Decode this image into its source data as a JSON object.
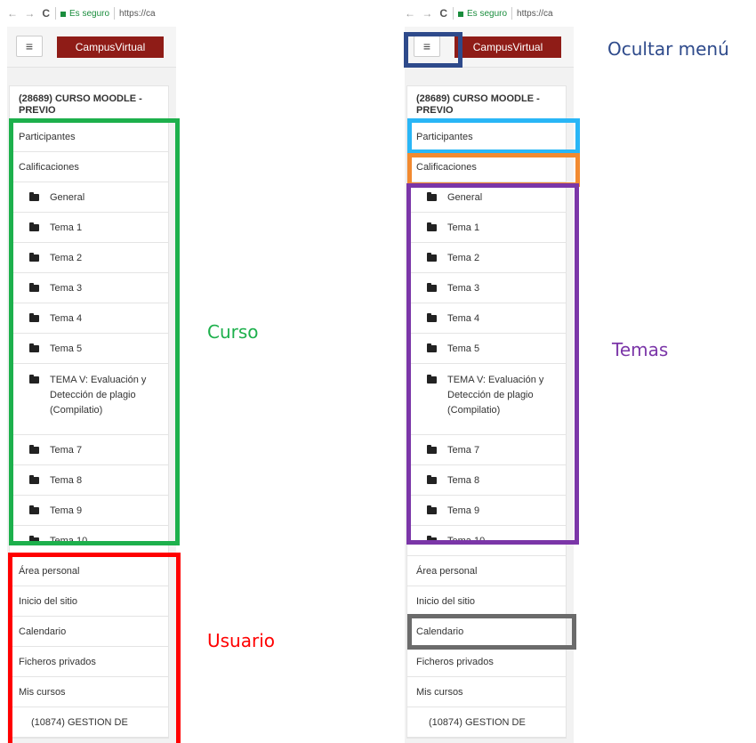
{
  "browser": {
    "nav_arrows": "← →",
    "reload_icon": "C",
    "secure_label": "Es seguro",
    "url": "https://ca"
  },
  "navbar": {
    "menu_icon": "≡",
    "brand": "CampusVirtual"
  },
  "course": {
    "title": "(28689) CURSO MOODLE - PREVIO",
    "links": [
      "Participantes",
      "Calificaciones"
    ],
    "topics": [
      "General",
      "Tema 1",
      "Tema 2",
      "Tema 3",
      "Tema 4",
      "Tema 5",
      "TEMA V: Evaluación y Detección de plagio (Compilatio)",
      "Tema 7",
      "Tema 8",
      "Tema 9",
      "Tema 10"
    ]
  },
  "user_nav": {
    "items": [
      "Área personal",
      "Inicio del sitio",
      "Calendario",
      "Ficheros privados",
      "Mis cursos"
    ],
    "sub_item": "(10874) GESTION DE"
  },
  "annotations": {
    "curso": "Curso",
    "usuario": "Usuario",
    "ocultar_menu": "Ocultar menú",
    "temas": "Temas"
  },
  "colors": {
    "curso": "#1db04c",
    "usuario": "#ff0000",
    "ocultar_menu": "#2e4a8b",
    "participantes": "#29b6f6",
    "calificaciones": "#f28a30",
    "temas": "#7b36a8",
    "calendario": "#6b6b6b",
    "brand": "#8f1c17"
  }
}
